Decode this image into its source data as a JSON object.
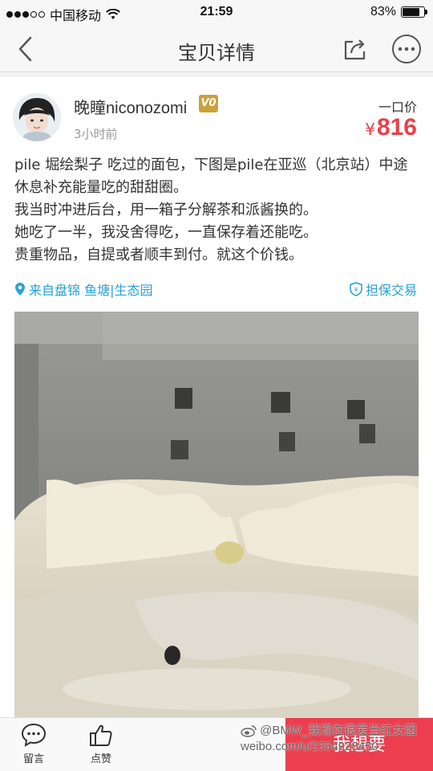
{
  "status_bar": {
    "carrier": "中国移动",
    "time": "21:59",
    "battery_text": "83%",
    "battery_level": 0.83
  },
  "nav": {
    "title": "宝贝详情",
    "icons": [
      "back-icon",
      "share-icon",
      "more-icon"
    ]
  },
  "seller": {
    "name": "晚瞳niconozomi",
    "badge": "V0",
    "post_time": "3小时前"
  },
  "price": {
    "label": "一口价",
    "currency": "¥",
    "amount": "816"
  },
  "description": {
    "lines": [
      "pile 堀绘梨子 吃过的面包，下图是pile在亚巡（北京站）中途休息补充能量吃的甜甜圈。",
      "我当时冲进后台，用一箱子分解茶和派酱换的。",
      "她吃了一半，我没舍得吃，一直保存着还能吃。",
      "贵重物品，自提或者顺丰到付。就这个价钱。"
    ]
  },
  "location": {
    "text": "来自盘锦 鱼塘|生态园"
  },
  "guarantee": {
    "text": "担保交易"
  },
  "bottom_bar": {
    "comment_label": "留言",
    "like_label": "点赞",
    "want_label": "我想要"
  },
  "watermark": {
    "line1": "@BMW_我现在很爱当红女团",
    "line2": "weibo.com/u/2354928450"
  },
  "colors": {
    "accent_red": "#e8404a",
    "link_blue": "#2aa0d8",
    "want_button": "#ec3e4e"
  }
}
